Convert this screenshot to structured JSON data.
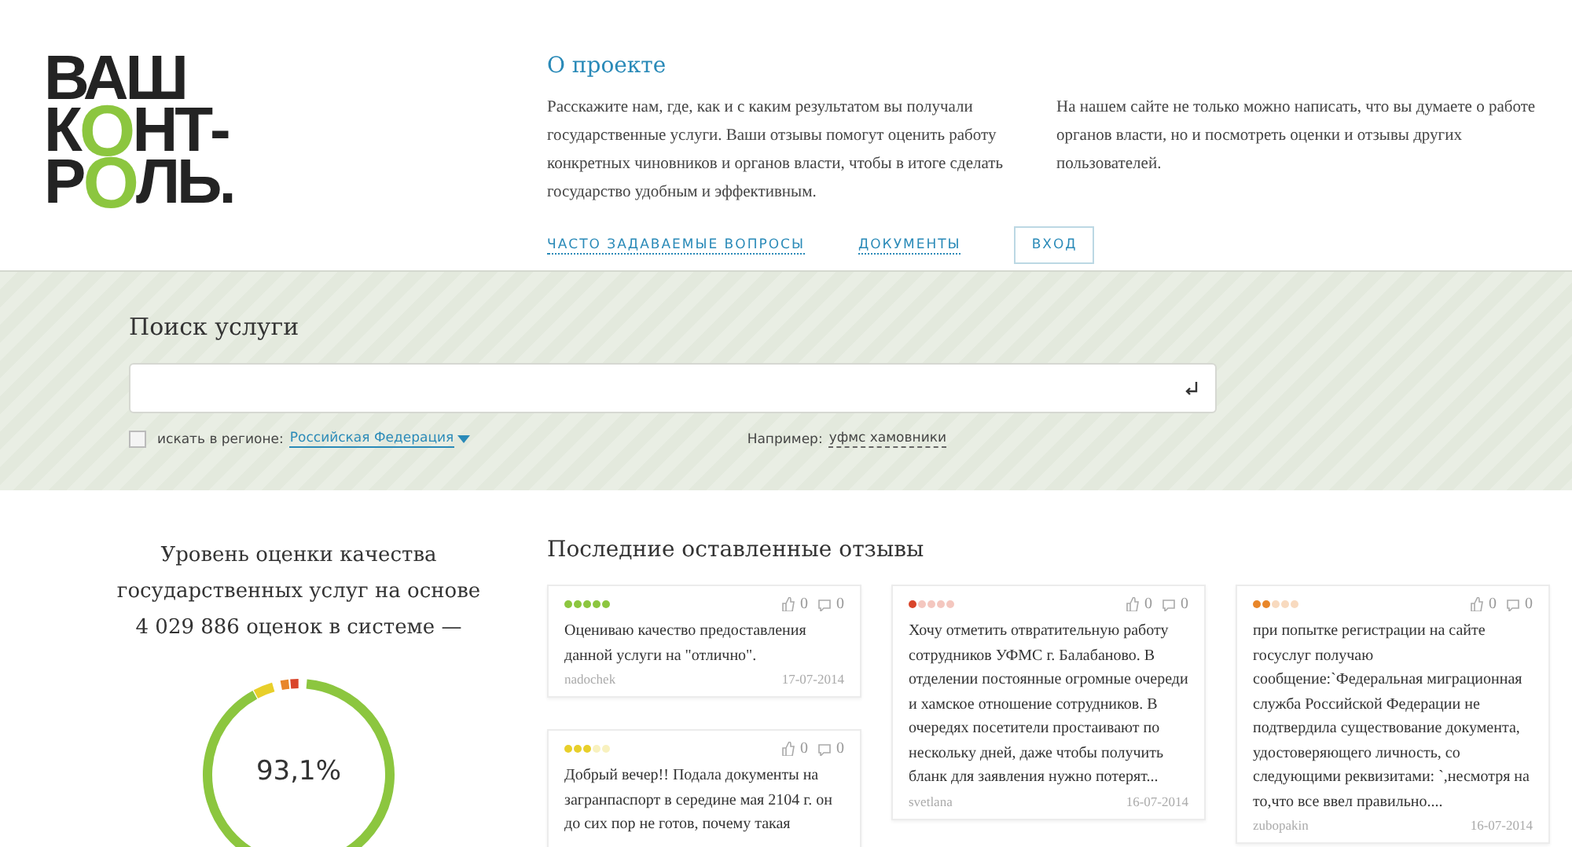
{
  "logo": [
    [
      {
        "text": "ВАШ",
        "accent": false
      }
    ],
    [
      {
        "text": "К",
        "accent": false
      },
      {
        "text": "О",
        "accent": true
      },
      {
        "text": "НТ-",
        "accent": false
      }
    ],
    [
      {
        "text": "Р",
        "accent": false
      },
      {
        "text": "О",
        "accent": true
      },
      {
        "text": "ЛЬ.",
        "accent": false
      }
    ]
  ],
  "about": {
    "title": "О проекте",
    "paragraphs": [
      "Расскажите нам, где, как и с каким результатом вы получали государственные услуги. Ваши отзывы помогут оценить работу конкретных чиновников и органов власти, чтобы в итоге сделать государство удобным и эффективным.",
      "На нашем сайте не только можно написать, что вы думаете о работе органов власти, но и посмотреть оценки и отзывы других пользователей."
    ],
    "links": [
      "ЧАСТО ЗАДАВАЕМЫЕ ВОПРОСЫ",
      "ДОКУМЕНТЫ"
    ],
    "login": "ВХОД"
  },
  "search": {
    "title": "Поиск услуги",
    "region_checked": false,
    "region_label": "искать в регионе:",
    "region": "Российская Федерация",
    "example_label": "Например:",
    "example": "уфмс хамовники"
  },
  "rating": {
    "text": "Уровень оценки качества государственных услуг на основе 4 029 886 оценок в системе —",
    "percent": "93,1%"
  },
  "reviews": {
    "title": "Последние оставленные отзывы",
    "columns": [
      [
        {
          "stars": 5,
          "color": "#8cc63f",
          "likes": "0",
          "comments": "0",
          "text": "Оцениваю качество предоставления данной услуги на \"отлично\".",
          "author": "nadochek",
          "date": "17-07-2014"
        },
        {
          "stars": 3,
          "color": "#e8cf2a",
          "likes": "0",
          "comments": "0",
          "text": "Добрый вечер!! Подала документы на загранпаспорт в середине мая 2104 г. он до сих пор не готов, почему такая"
        }
      ],
      [
        {
          "stars": 1,
          "color": "#d9452b",
          "likes": "0",
          "comments": "0",
          "text": "Хочу отметить отвратительную работу сотрудников УФМС г. Балабаново. В отделении постоянные огромные очереди и хамское отношение сотрудников. В очередях посетители простаивают по нескольку дней, даже чтобы получить бланк для заявления нужно потерят...",
          "author": "svetlana",
          "date": "16-07-2014"
        }
      ],
      [
        {
          "stars": 2,
          "color": "#e8862a",
          "likes": "0",
          "comments": "0",
          "text": "при попытке регистрации на сайте госуслуг получаю сообщение:`Федеральная миграционная служба Российской Федерации не подтвердила существование документа, удостоверяющего личность, со следующими реквизитами: `,несмотря на то,что все ввел правильно....",
          "author": "zubopakin",
          "date": "16-07-2014"
        }
      ]
    ]
  }
}
